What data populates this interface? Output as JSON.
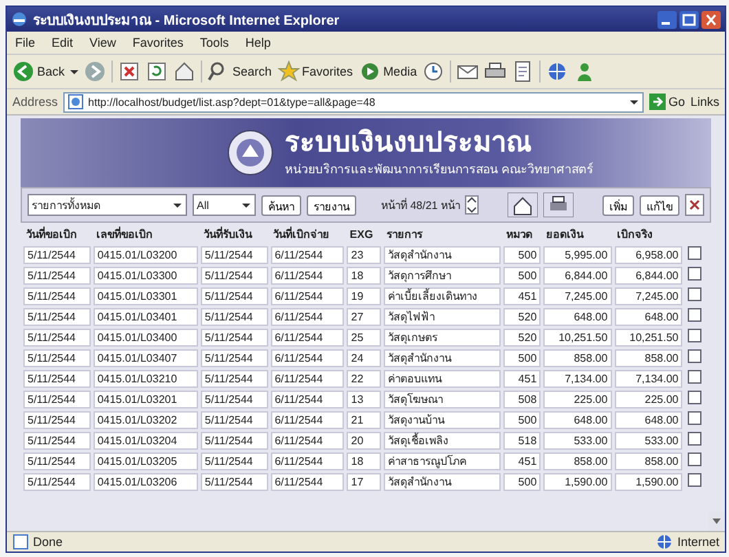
{
  "window": {
    "title": "ระบบเงินงบประมาณ - Microsoft Internet Explorer"
  },
  "menu": [
    "File",
    "Edit",
    "View",
    "Favorites",
    "Tools",
    "Help"
  ],
  "toolbar": {
    "labels": [
      "Back",
      "Search",
      "Favorites",
      "Media"
    ]
  },
  "address_bar": {
    "label": "Address",
    "url": "http://localhost/budget/list.asp?dept=01&type=all&page=48",
    "go": "Go",
    "links": "Links"
  },
  "banner": {
    "title": "ระบบเงินงบประมาณ",
    "subtitle": "หน่วยบริการและพัฒนาการเรียนการสอน คณะวิทยาศาสตร์"
  },
  "filter": {
    "department": "รายการทั้งหมด",
    "type": "All",
    "buttons": [
      "ค้นหา",
      "รายงาน"
    ],
    "page_info": "หน้าที่ 48/21 หน้า"
  },
  "actions": [
    "เพิ่ม",
    "แก้ไข"
  ],
  "table": {
    "columns": [
      "วันที่ขอเบิก",
      "เลขที่ขอเบิก",
      "วันที่รับเงิน",
      "วันที่เบิกจ่าย",
      "EXG",
      "รายการ",
      "หมวด",
      "ยอดเงิน",
      "เบิกจริง"
    ],
    "rows": [
      {
        "cells": [
          "5/11/2544",
          "0415.01/L03200",
          "5/11/2544",
          "6/11/2544",
          "23",
          "วัสดุสำนักงาน",
          "500",
          "5,995.00",
          "6,958.00"
        ],
        "checked": false
      },
      {
        "cells": [
          "5/11/2544",
          "0415.01/L03300",
          "5/11/2544",
          "6/11/2544",
          "18",
          "วัสดุการศึกษา",
          "500",
          "6,844.00",
          "6,844.00"
        ],
        "checked": false
      },
      {
        "cells": [
          "5/11/2544",
          "0415.01/L03301",
          "5/11/2544",
          "6/11/2544",
          "19",
          "ค่าเบี้ยเลี้ยงเดินทาง",
          "451",
          "7,245.00",
          "7,245.00"
        ],
        "checked": false
      },
      {
        "cells": [
          "5/11/2544",
          "0415.01/L03401",
          "5/11/2544",
          "6/11/2544",
          "27",
          "วัสดุไฟฟ้า",
          "520",
          "648.00",
          "648.00"
        ],
        "checked": false
      },
      {
        "cells": [
          "5/11/2544",
          "0415.01/L03400",
          "5/11/2544",
          "6/11/2544",
          "25",
          "วัสดุเกษตร",
          "520",
          "10,251.50",
          "10,251.50"
        ],
        "checked": false
      },
      {
        "cells": [
          "5/11/2544",
          "0415.01/L03407",
          "5/11/2544",
          "6/11/2544",
          "24",
          "วัสดุสำนักงาน",
          "500",
          "858.00",
          "858.00"
        ],
        "checked": false
      },
      {
        "cells": [
          "5/11/2544",
          "0415.01/L03210",
          "5/11/2544",
          "6/11/2544",
          "22",
          "ค่าตอบแทน",
          "451",
          "7,134.00",
          "7,134.00"
        ],
        "checked": false
      },
      {
        "cells": [
          "5/11/2544",
          "0415.01/L03201",
          "5/11/2544",
          "6/11/2544",
          "13",
          "วัสดุโฆษณา",
          "508",
          "225.00",
          "225.00"
        ],
        "checked": false
      },
      {
        "cells": [
          "5/11/2544",
          "0415.01/L03202",
          "5/11/2544",
          "6/11/2544",
          "21",
          "วัสดุงานบ้าน",
          "500",
          "648.00",
          "648.00"
        ],
        "checked": false
      },
      {
        "cells": [
          "5/11/2544",
          "0415.01/L03204",
          "5/11/2544",
          "6/11/2544",
          "20",
          "วัสดุเชื้อเพลิง",
          "518",
          "533.00",
          "533.00"
        ],
        "checked": false
      },
      {
        "cells": [
          "5/11/2544",
          "0415.01/L03205",
          "5/11/2544",
          "6/11/2544",
          "18",
          "ค่าสาธารณูปโภค",
          "451",
          "858.00",
          "858.00"
        ],
        "checked": false
      },
      {
        "cells": [
          "5/11/2544",
          "0415.01/L03206",
          "5/11/2544",
          "6/11/2544",
          "17",
          "วัสดุสำนักงาน",
          "500",
          "1,590.00",
          "1,590.00"
        ],
        "checked": false
      }
    ]
  },
  "status_bar": {
    "text": "Done",
    "zone": "Internet"
  }
}
